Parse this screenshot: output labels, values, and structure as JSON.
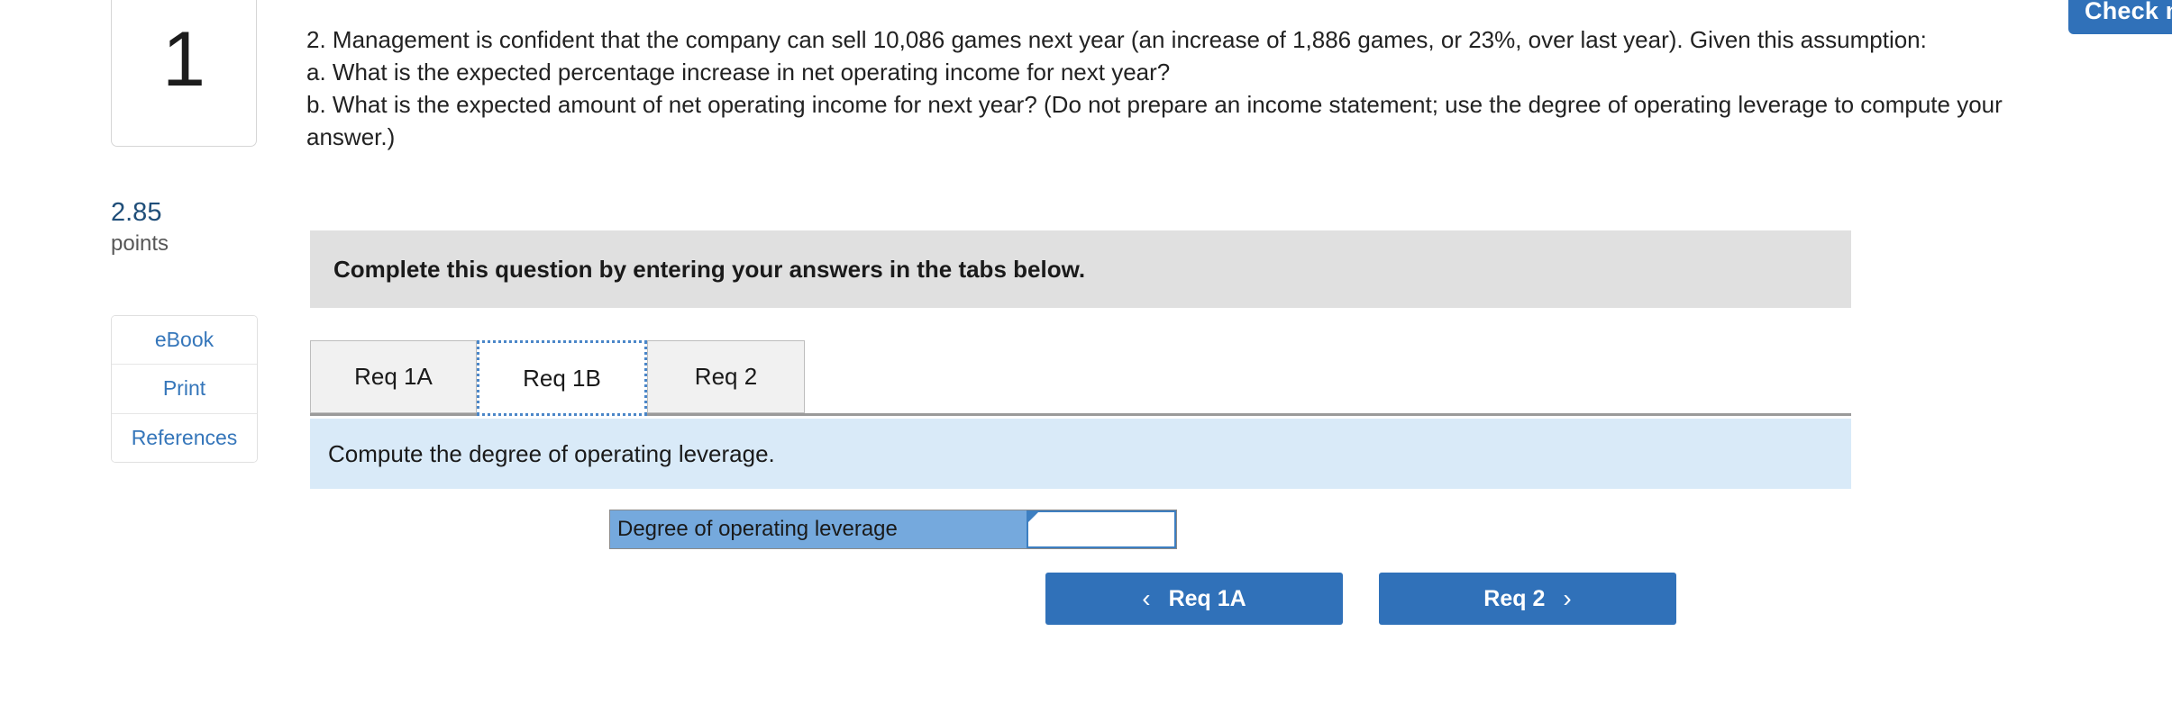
{
  "check_button": {
    "label": "Check my work"
  },
  "left_rail": {
    "question_number": "1",
    "points_value": "2.85",
    "points_label": "points",
    "resources": [
      {
        "label": "eBook"
      },
      {
        "label": "Print"
      },
      {
        "label": "References"
      }
    ]
  },
  "question": {
    "lines": [
      "2. Management is confident that the company can sell 10,086 games next year (an increase of 1,886 games, or 23%, over last year). Given this assumption:",
      "a. What is the expected percentage increase in net operating income for next year?",
      "b. What is the expected amount of net operating income for next year? (Do not prepare an income statement; use the degree of operating leverage to compute your answer.)"
    ]
  },
  "instruction_banner": {
    "text": "Complete this question by entering your answers in the tabs below."
  },
  "tabs": [
    {
      "label": "Req 1A",
      "active": false
    },
    {
      "label": "Req 1B",
      "active": true
    },
    {
      "label": "Req 2",
      "active": false
    }
  ],
  "requirement_panel": {
    "text": "Compute the degree of operating leverage."
  },
  "answer_row": {
    "label": "Degree of operating leverage",
    "value": "",
    "placeholder": ""
  },
  "nav": {
    "prev_label": "Req 1A",
    "prev_chevron": "‹",
    "next_label": "Req 2",
    "next_chevron": "›"
  },
  "colors": {
    "primary_blue": "#3071b9",
    "panel_blue": "#d9eaf8",
    "row_blue": "#75a9dd",
    "banner_gray": "#e0e0e0",
    "link_blue": "#3576ba",
    "points_blue": "#1f4e79"
  }
}
